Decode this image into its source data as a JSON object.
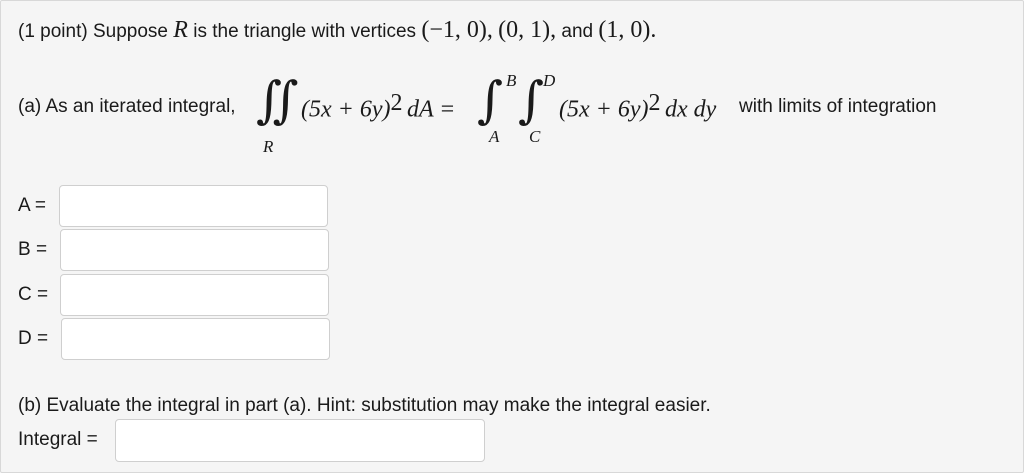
{
  "intro": {
    "prefix": "(1 point) Suppose",
    "region": "R",
    "middle": "is the triangle with vertices",
    "v1": "(−1, 0),",
    "v2": "(0, 1),",
    "and": "and",
    "v3": "(1, 0)."
  },
  "part_a": {
    "prefix": "(a) As an iterated integral,",
    "integral_sub": "R",
    "integrand_left": "(5x + 6y)",
    "exp_left": "2",
    "dA": "dA =",
    "lim_upper_outer": "B",
    "lim_lower_outer": "A",
    "lim_upper_inner": "D",
    "lim_lower_inner": "C",
    "integrand_right": "(5x + 6y)",
    "exp_right": "2",
    "differentials": "dx dy",
    "suffix": "with limits of integration"
  },
  "fields": [
    {
      "label": "A =",
      "value": ""
    },
    {
      "label": "B =",
      "value": ""
    },
    {
      "label": "C =",
      "value": ""
    },
    {
      "label": "D =",
      "value": ""
    }
  ],
  "part_b": {
    "text": "(b) Evaluate the integral in part (a). Hint: substitution may make the integral easier.",
    "label": "Integral =",
    "value": ""
  }
}
